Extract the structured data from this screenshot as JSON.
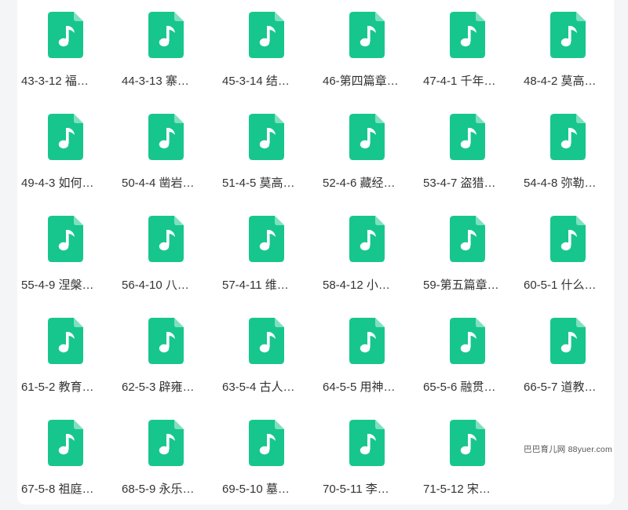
{
  "icon": {
    "name": "audio-file-icon",
    "color": "#17c68c"
  },
  "files": [
    "43-3-12 福…",
    "44-3-13 寨…",
    "45-3-14 结…",
    "46-第四篇章…",
    "47-4-1 千年…",
    "48-4-2 莫高…",
    "49-4-3 如何…",
    "50-4-4 凿岩…",
    "51-4-5 莫高…",
    "52-4-6 藏经…",
    "53-4-7 盗猎…",
    "54-4-8 弥勒…",
    "55-4-9 涅槃…",
    "56-4-10 八…",
    "57-4-11 维…",
    "58-4-12 小…",
    "59-第五篇章…",
    "60-5-1 什么…",
    "61-5-2 教育…",
    "62-5-3 辟雍…",
    "63-5-4 古人…",
    "64-5-5 用神…",
    "65-5-6 融贯…",
    "66-5-7 道教…",
    "67-5-8 祖庭…",
    "68-5-9 永乐…",
    "69-5-10 墓…",
    "70-5-11 李…",
    "71-5-12 宋…"
  ],
  "watermark": "巴巴育儿网 88yuer.com"
}
